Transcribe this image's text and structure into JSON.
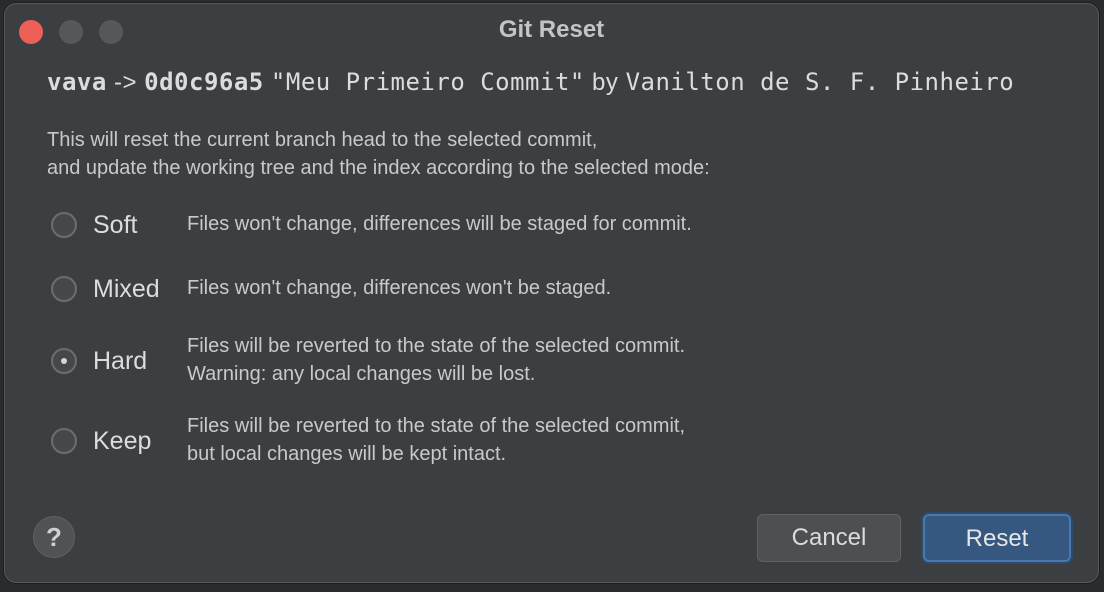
{
  "window": {
    "title": "Git Reset"
  },
  "commit": {
    "branch": "vava",
    "arrow": "->",
    "hash": "0d0c96a5",
    "message": "\"Meu Primeiro Commit\"",
    "by": "by",
    "author": "Vanilton de S. F. Pinheiro"
  },
  "description": {
    "line1": "This will reset the current branch head to the selected commit,",
    "line2": "and update the working tree and the index according to the selected mode:"
  },
  "modes": [
    {
      "label": "Soft",
      "checked": false,
      "desc1": "Files won't change, differences will be staged for commit.",
      "desc2": ""
    },
    {
      "label": "Mixed",
      "checked": false,
      "desc1": "Files won't change, differences won't be staged.",
      "desc2": ""
    },
    {
      "label": "Hard",
      "checked": true,
      "desc1": "Files will be reverted to the state of the selected commit.",
      "desc2": "Warning: any local changes will be lost."
    },
    {
      "label": "Keep",
      "checked": false,
      "desc1": "Files will be reverted to the state of the selected commit,",
      "desc2": "but local changes will be kept intact."
    }
  ],
  "buttons": {
    "help": "?",
    "cancel": "Cancel",
    "reset": "Reset"
  },
  "colors": {
    "close_button": "#ee5f57",
    "dialog_background": "#3c3f41",
    "primary_button": "#365880"
  }
}
